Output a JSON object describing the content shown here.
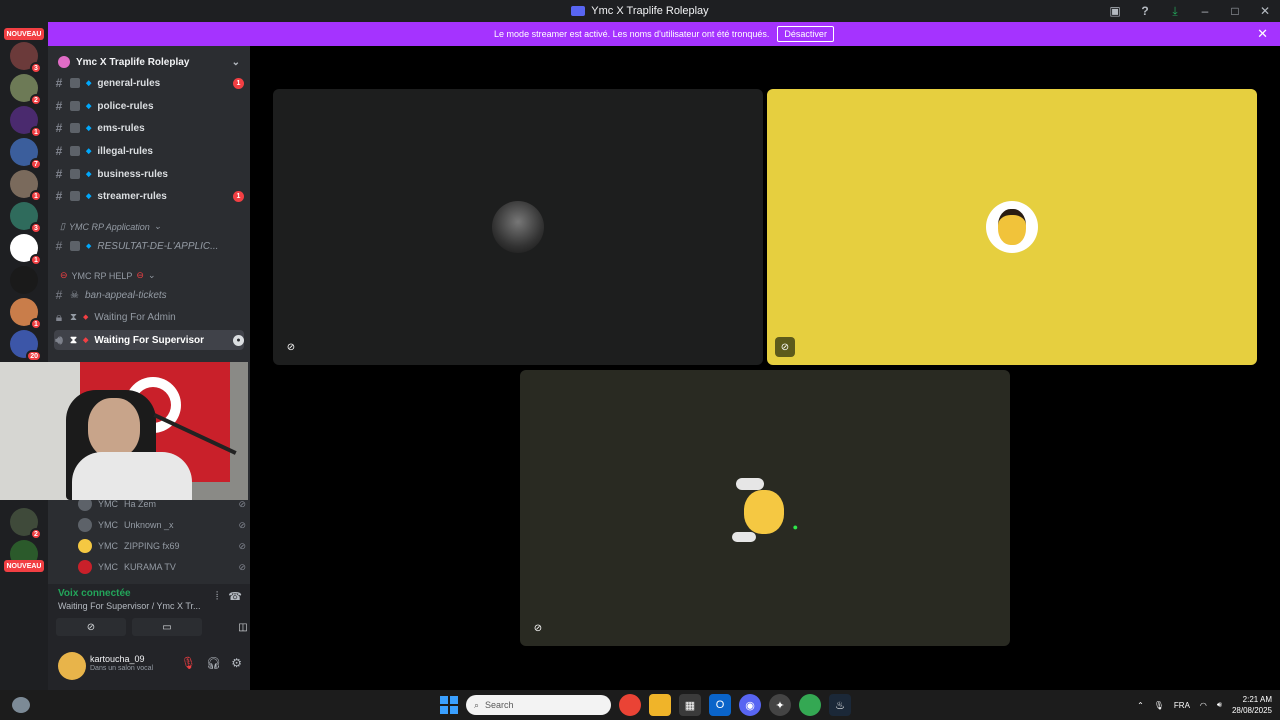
{
  "window": {
    "title": "Ymc X Traplife Roleplay"
  },
  "banner": {
    "text": "Le mode streamer est activé. Les noms d'utilisateur ont été tronqués.",
    "button": "Désactiver"
  },
  "guilds": {
    "nouveau_top": "NOUVEAU",
    "nouveau_bottom": "NOUVEAU",
    "badges": [
      "3",
      "2",
      "1",
      "7",
      "1",
      "3",
      "1",
      "1",
      "20",
      "2"
    ]
  },
  "server": {
    "name": "Ymc X Traplife Roleplay"
  },
  "channels": [
    {
      "name": "general-rules",
      "mention": "1"
    },
    {
      "name": "police-rules"
    },
    {
      "name": "ems-rules"
    },
    {
      "name": "illegal-rules"
    },
    {
      "name": "business-rules"
    },
    {
      "name": "streamer-rules",
      "mention": "1"
    }
  ],
  "categories": {
    "application": "YMC RP Application",
    "help": "YMC RP HELP"
  },
  "channels2": [
    {
      "name": "RESULTAT-DE-L'APPLIC..."
    },
    {
      "name": "ban-appeal-tickets"
    },
    {
      "name": "Waiting For Admin"
    },
    {
      "name": "Waiting For Supervisor"
    }
  ],
  "voice_users": [
    {
      "prefix": "YMC",
      "name": "Ha Zem"
    },
    {
      "prefix": "YMC",
      "name": "Unknown _x"
    },
    {
      "prefix": "YMC",
      "name": "ZIPPING fx69"
    },
    {
      "prefix": "YMC",
      "name": "KURAMA TV"
    }
  ],
  "voice_panel": {
    "status": "Voix connectée",
    "channel": "Waiting For Supervisor / Ymc X Tr..."
  },
  "user_panel": {
    "username": "kartoucha_09",
    "status": "Dans un salon vocal"
  },
  "taskbar": {
    "search_placeholder": "Search",
    "language": "FRA",
    "time": "2:21 AM",
    "date": "28/08/2025"
  },
  "icons": {
    "mute": "mic-muted-icon",
    "headphones": "headphones-icon",
    "settings": "gear-icon"
  },
  "colors": {
    "banner": "#a533ff",
    "tile_yellow": "#e6cf3f",
    "connected": "#23a55a",
    "mention": "#f23f43"
  }
}
